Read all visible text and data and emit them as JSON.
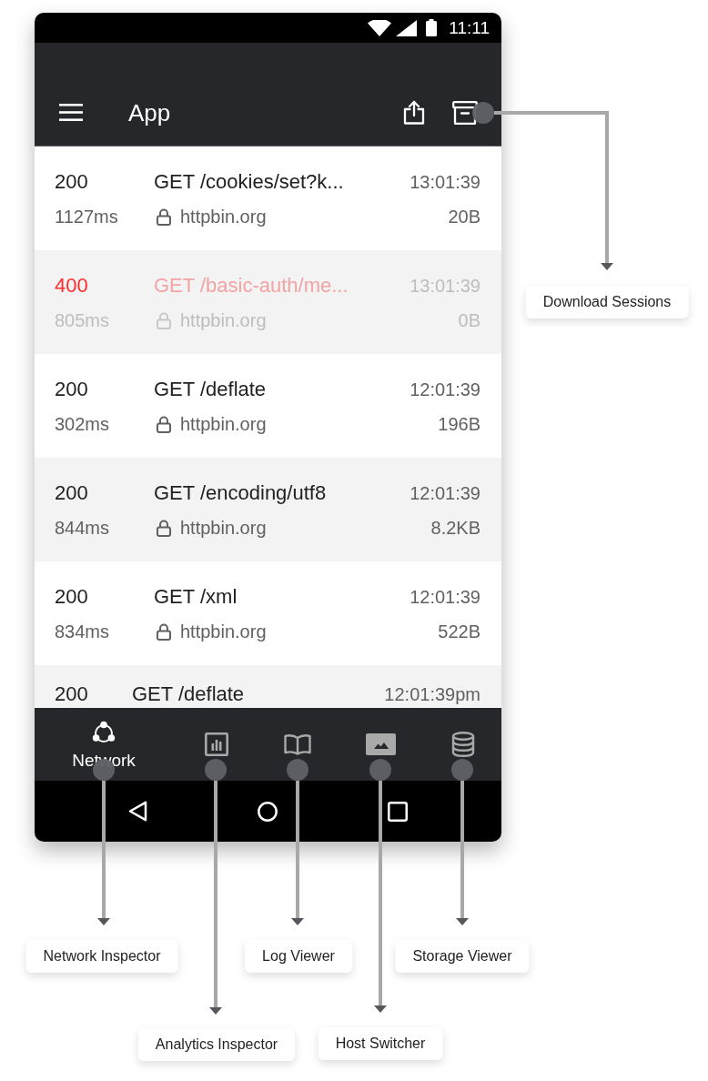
{
  "status_bar": {
    "time": "11:11"
  },
  "app_bar": {
    "title": "App"
  },
  "requests": [
    {
      "kind": "full",
      "status": "200",
      "error": false,
      "path": "GET /cookies/set?k...",
      "time": "13:01:39",
      "duration": "1127ms",
      "host": "httpbin.org",
      "size": "20B"
    },
    {
      "kind": "full",
      "status": "400",
      "error": true,
      "path": "GET /basic-auth/me...",
      "time": "13:01:39",
      "duration": "805ms",
      "host": "httpbin.org",
      "size": "0B"
    },
    {
      "kind": "full",
      "status": "200",
      "error": false,
      "path": "GET /deflate",
      "time": "12:01:39",
      "duration": "302ms",
      "host": "httpbin.org",
      "size": "196B"
    },
    {
      "kind": "full",
      "status": "200",
      "error": false,
      "path": "GET /encoding/utf8",
      "time": "12:01:39",
      "duration": "844ms",
      "host": "httpbin.org",
      "size": "8.2KB"
    },
    {
      "kind": "full",
      "status": "200",
      "error": false,
      "path": "GET /xml",
      "time": "12:01:39",
      "duration": "834ms",
      "host": "httpbin.org",
      "size": "522B"
    },
    {
      "kind": "peek",
      "status": "200",
      "error": false,
      "path": "GET /deflate",
      "time": "12:01:39pm"
    }
  ],
  "bottom_nav": {
    "items": [
      {
        "label": "Network",
        "selected": true
      },
      {
        "selected": false
      },
      {
        "selected": false
      },
      {
        "selected": false
      },
      {
        "selected": false
      }
    ]
  },
  "callouts": [
    {
      "label": "Download Sessions"
    },
    {
      "label": "Network Inspector"
    },
    {
      "label": "Analytics Inspector"
    },
    {
      "label": "Log Viewer"
    },
    {
      "label": "Host Switcher"
    },
    {
      "label": "Storage Viewer"
    }
  ]
}
